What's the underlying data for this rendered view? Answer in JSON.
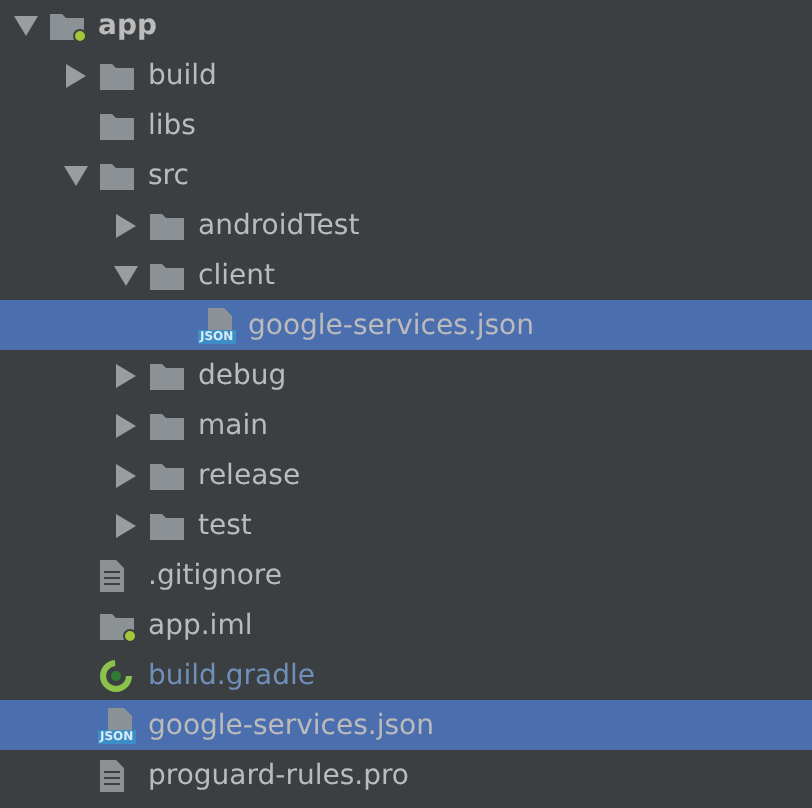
{
  "tree": [
    {
      "name": "app",
      "kind": "module",
      "expanded": true,
      "selected": false,
      "children": [
        {
          "name": "build",
          "kind": "folder",
          "expanded": false,
          "selected": false
        },
        {
          "name": "libs",
          "kind": "folder",
          "selected": false
        },
        {
          "name": "src",
          "kind": "folder",
          "expanded": true,
          "selected": false,
          "children": [
            {
              "name": "androidTest",
              "kind": "folder",
              "expanded": false,
              "selected": false
            },
            {
              "name": "client",
              "kind": "folder",
              "expanded": true,
              "selected": false,
              "children": [
                {
                  "name": "google-services.json",
                  "kind": "json",
                  "icon_label": "JSON",
                  "selected": true
                }
              ]
            },
            {
              "name": "debug",
              "kind": "folder",
              "expanded": false,
              "selected": false
            },
            {
              "name": "main",
              "kind": "folder",
              "expanded": false,
              "selected": false
            },
            {
              "name": "release",
              "kind": "folder",
              "expanded": false,
              "selected": false
            },
            {
              "name": "test",
              "kind": "folder",
              "expanded": false,
              "selected": false
            }
          ]
        },
        {
          "name": ".gitignore",
          "kind": "file",
          "selected": false
        },
        {
          "name": "app.iml",
          "kind": "iml",
          "selected": false
        },
        {
          "name": "build.gradle",
          "kind": "gradle",
          "selected": false
        },
        {
          "name": "google-services.json",
          "kind": "json",
          "icon_label": "JSON",
          "selected": true
        },
        {
          "name": "proguard-rules.pro",
          "kind": "file",
          "selected": false
        }
      ]
    }
  ]
}
